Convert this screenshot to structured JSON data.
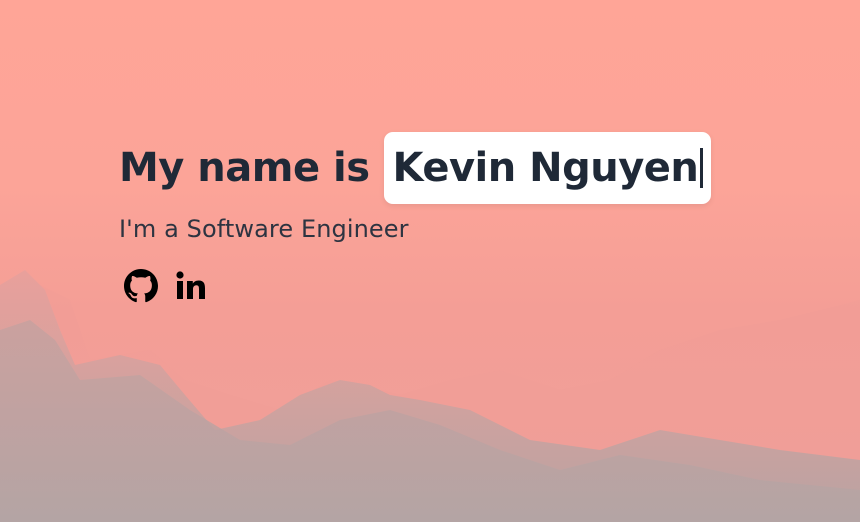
{
  "hero": {
    "prefix": "My name is",
    "name": "Kevin Nguyen",
    "subtitle": "I'm a Software Engineer"
  },
  "socials": [
    {
      "icon": "github-icon",
      "label": "GitHub"
    },
    {
      "icon": "linkedin-icon",
      "label": "LinkedIn"
    }
  ],
  "colors": {
    "sky": "#ffa597",
    "mountains": "#b6a0a0",
    "text": "#1f2937",
    "name_box": "#ffffff"
  }
}
